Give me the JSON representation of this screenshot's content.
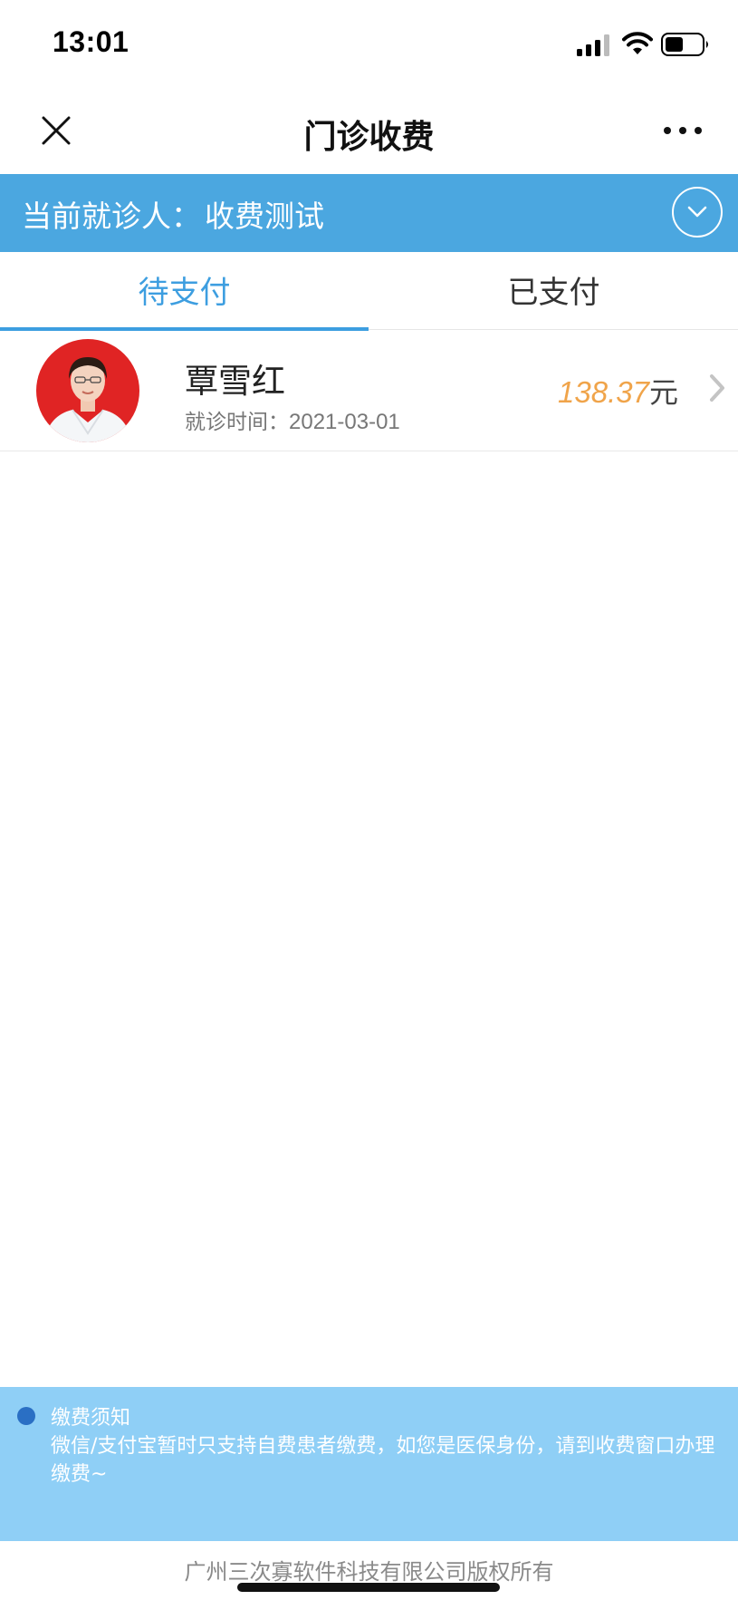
{
  "status_bar": {
    "time": "13:01"
  },
  "nav": {
    "title": "门诊收费"
  },
  "patient": {
    "label": "当前就诊人：",
    "name": "收费测试"
  },
  "tabs": [
    {
      "label": "待支付",
      "active": true
    },
    {
      "label": "已支付",
      "active": false
    }
  ],
  "bills": [
    {
      "doctor": "覃雪红",
      "visit_label": "就诊时间：",
      "visit_date": "2021-03-01",
      "amount": "138.37",
      "unit": "元"
    }
  ],
  "notice": {
    "title": "缴费须知",
    "body": "微信/支付宝暂时只支持自费患者缴费，如您是医保身份，请到收费窗口办理缴费~"
  },
  "footer": {
    "copyright": "广州三次寡软件科技有限公司版权所有"
  },
  "colors": {
    "accent": "#3d9ee0",
    "patient_bar": "#4ba7e0",
    "amount": "#f0a44a",
    "notice_bg": "#8fcff6"
  },
  "icons": [
    "signal-icon",
    "wifi-icon",
    "battery-icon",
    "close-icon",
    "more-icon",
    "chevron-down-icon",
    "chevron-right-icon"
  ]
}
